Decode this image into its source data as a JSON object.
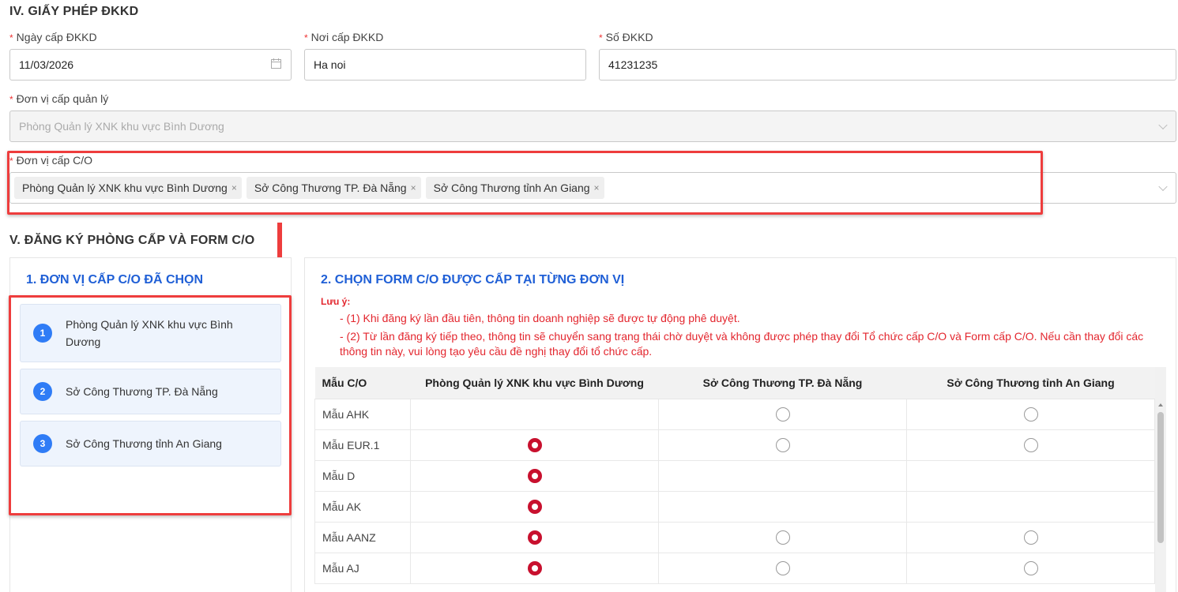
{
  "section4": {
    "title": "IV. GIẤY PHÉP ĐKKD",
    "required_mark": "*",
    "issue_date": {
      "label": "Ngày cấp ĐKKD",
      "value": "11/03/2026",
      "icon": "calendar-icon"
    },
    "issue_place": {
      "label": "Nơi cấp ĐKKD",
      "value": "Ha noi"
    },
    "license_number": {
      "label": "Số ĐKKD",
      "value": "41231235"
    },
    "managing_unit": {
      "label": "Đơn vị cấp quản lý",
      "value": "Phòng Quản lý XNK khu vực Bình Dương"
    },
    "co_units": {
      "label": "Đơn vị cấp C/O",
      "tags": [
        "Phòng Quản lý XNK khu vực Bình Dương",
        "Sở Công Thương TP. Đà Nẵng",
        "Sở Công Thương tỉnh An Giang"
      ],
      "remove_glyph": "×"
    }
  },
  "section5": {
    "title": "V. ĐĂNG KÝ PHÒNG CẤP VÀ FORM C/O",
    "selected_panel": {
      "title": "1. ĐƠN VỊ CẤP C/O ĐÃ CHỌN",
      "items": [
        {
          "num": "1",
          "name": "Phòng Quản lý XNK khu vực Bình Dương"
        },
        {
          "num": "2",
          "name": "Sở Công Thương TP. Đà Nẵng"
        },
        {
          "num": "3",
          "name": "Sở Công Thương tỉnh An Giang"
        }
      ]
    },
    "forms_panel": {
      "title": "2. CHỌN FORM C/O ĐƯỢC CẤP TẠI TỪNG ĐƠN VỊ",
      "note_title": "Lưu ý:",
      "notes": [
        "- (1) Khi đăng ký lần đầu tiên, thông tin doanh nghiệp sẽ được tự động phê duyệt.",
        "- (2) Từ lần đăng ký tiếp theo, thông tin sẽ chuyển sang trạng thái chờ duyệt và không được phép thay đổi Tổ chức cấp C/O và Form cấp C/O. Nếu cần thay đổi các",
        "thông tin này, vui lòng tạo yêu cầu đề nghị thay đổi tổ chức cấp."
      ],
      "table": {
        "headers": [
          "Mẫu C/O",
          "Phòng Quản lý XNK khu vực Bình Dương",
          "Sở Công Thương TP. Đà Nẵng",
          "Sở Công Thương tỉnh An Giang"
        ],
        "rows": [
          {
            "form": "Mẫu AHK",
            "cells": [
              "none",
              "unchecked",
              "unchecked"
            ]
          },
          {
            "form": "Mẫu EUR.1",
            "cells": [
              "checked",
              "unchecked",
              "unchecked"
            ]
          },
          {
            "form": "Mẫu D",
            "cells": [
              "checked",
              "none",
              "none"
            ]
          },
          {
            "form": "Mẫu AK",
            "cells": [
              "checked",
              "none",
              "none"
            ]
          },
          {
            "form": "Mẫu AANZ",
            "cells": [
              "checked",
              "unchecked",
              "unchecked"
            ]
          },
          {
            "form": "Mẫu AJ",
            "cells": [
              "checked",
              "unchecked",
              "unchecked"
            ]
          }
        ]
      }
    }
  },
  "colors": {
    "accent_blue": "#1f5fd6",
    "badge_blue": "#2f7cf6",
    "highlight_red": "#ee3d3d",
    "note_red": "#e3262e",
    "radio_checked": "#c8102e"
  }
}
